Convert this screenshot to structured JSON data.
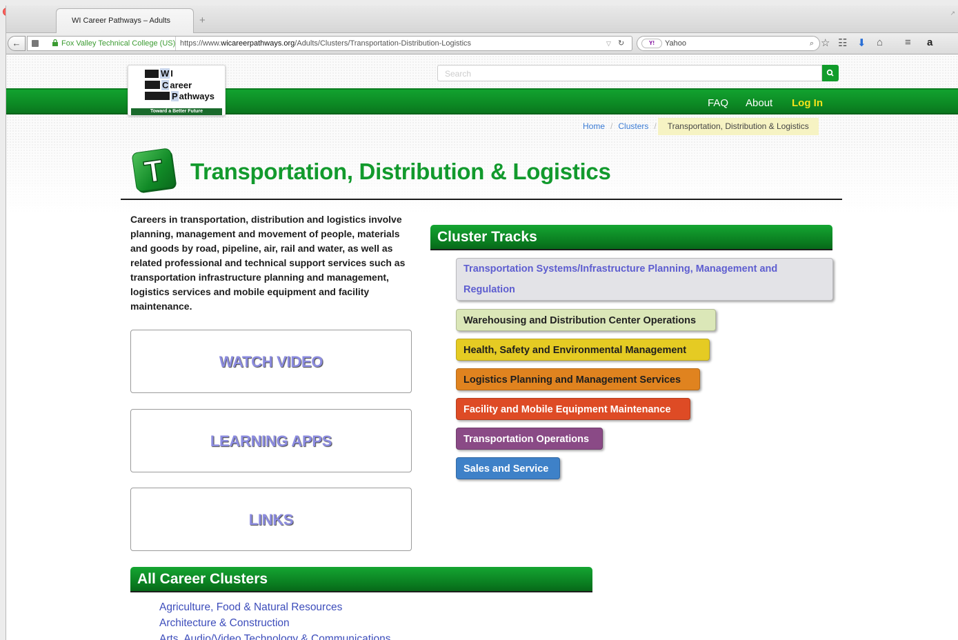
{
  "browser": {
    "tab_title": "WI Career Pathways – Adults",
    "new_tab": "+",
    "identity_label": "Fox Valley Technical College (US)",
    "url_prefix": "https://www.",
    "url_domain": "wicareerpathways.org",
    "url_path": "/Adults/Clusters/Transportation-Distribution-Logistics",
    "search_engine_logo": "Y!",
    "search_engine": "Yahoo",
    "toolbar_icons": [
      "star-icon",
      "reading-list-icon",
      "download-icon",
      "home-icon",
      "menu-icon",
      "amazon-icon"
    ]
  },
  "site": {
    "search_placeholder": "Search",
    "logo": {
      "line1_letter": "W",
      "line1_rest": "I",
      "line2_letter": "C",
      "line2_rest": "areer",
      "line3_letter": "P",
      "line3_rest": "athways",
      "tagline": "Toward a Better Future"
    },
    "nav": {
      "faq": "FAQ",
      "about": "About",
      "login": "Log In"
    },
    "colors": {
      "brand_green": "#129a2d",
      "login_yellow": "#f4e21c",
      "link_blue": "#3d4dbb"
    }
  },
  "breadcrumb": {
    "home": "Home",
    "sep": "/",
    "clusters": "Clusters",
    "current": "Transportation, Distribution & Logistics"
  },
  "page": {
    "icon_letter": "T",
    "title": "Transportation, Distribution & Logistics",
    "intro": "Careers in transportation, distribution and logistics involve planning, management and movement of people, materials and goods by road, pipeline, air, rail and water, as well as related professional and technical support services such as transportation infrastructure planning and management, logistics services and mobile equipment and facility maintenance."
  },
  "buttons": {
    "watch_video": "WATCH VIDEO",
    "learning_apps": "LEARNING APPS",
    "links": "LINKS"
  },
  "cluster_tracks": {
    "heading": "Cluster Tracks",
    "items": [
      {
        "label": "Transportation Systems/Infrastructure Planning, Management and Regulation",
        "color": "#e3e3e7"
      },
      {
        "label": "Warehousing and Distribution Center Operations",
        "color": "#dbe7b8"
      },
      {
        "label": "Health, Safety and Environmental Management",
        "color": "#e5cb23"
      },
      {
        "label": "Logistics Planning and Management Services",
        "color": "#e0831f"
      },
      {
        "label": "Facility and Mobile Equipment Maintenance",
        "color": "#de4b25"
      },
      {
        "label": "Transportation Operations",
        "color": "#8a4a86"
      },
      {
        "label": "Sales and Service",
        "color": "#3e81c8"
      }
    ]
  },
  "all_clusters": {
    "heading": "All Career Clusters",
    "items": [
      "Agriculture, Food & Natural Resources",
      "Architecture & Construction",
      "Arts, Audio/Video Technology & Communications"
    ]
  }
}
